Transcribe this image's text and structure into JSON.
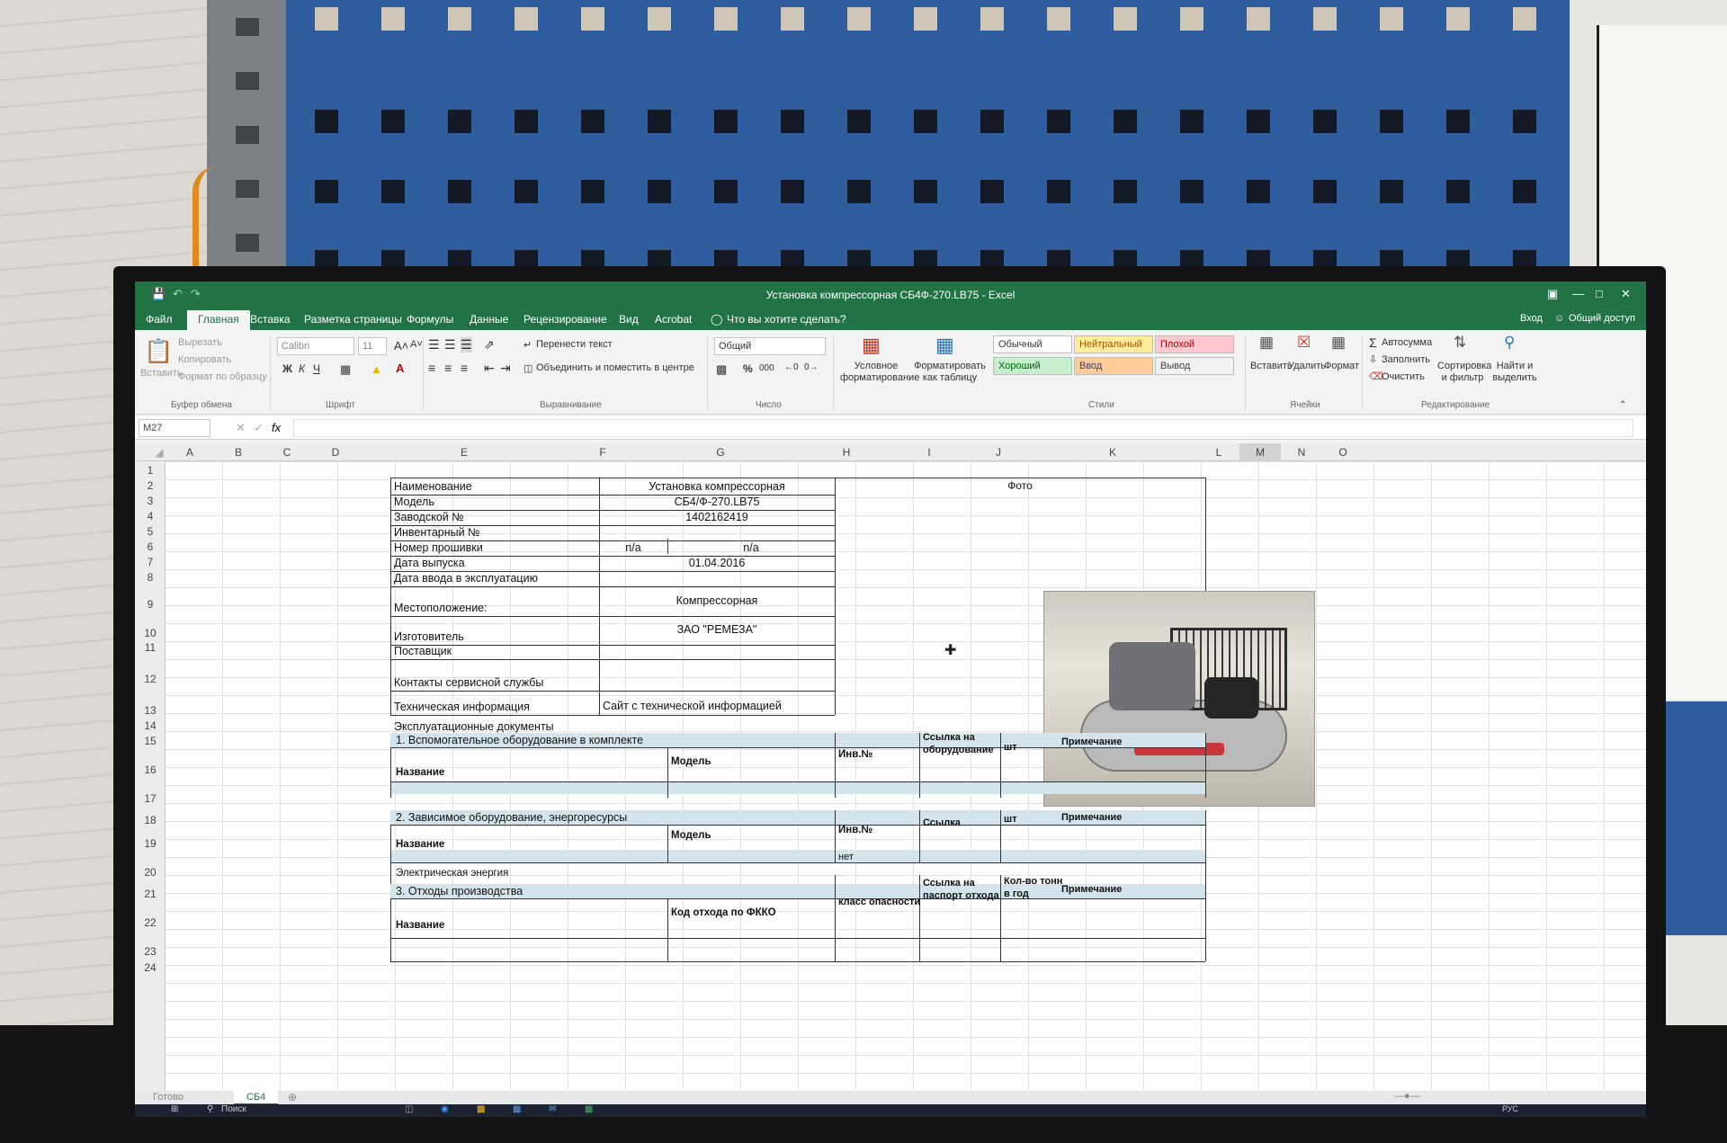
{
  "window": {
    "title": "Установка компрессорная СБ4Ф-270.LB75 - Excel",
    "sign_in": "Вход",
    "share": "Общий доступ"
  },
  "tabs": [
    "Файл",
    "Главная",
    "Вставка",
    "Разметка страницы",
    "Формулы",
    "Данные",
    "Рецензирование",
    "Вид",
    "Acrobat"
  ],
  "active_tab": "Главная",
  "tell_me": "Что вы хотите сделать?",
  "ribbon": {
    "clipboard": {
      "paste": "Вставить",
      "cut": "Вырезать",
      "copy": "Копировать",
      "format_painter": "Формат по образцу",
      "group": "Буфер обмена"
    },
    "font": {
      "name": "Calibri",
      "size": "11",
      "bold": "Ж",
      "italic": "К",
      "underline": "Ч",
      "group": "Шрифт"
    },
    "alignment": {
      "wrap": "Перенести текст",
      "merge": "Объединить и поместить в центре",
      "group": "Выравнивание"
    },
    "number": {
      "format": "Общий",
      "percent": "%",
      "thousands": "000",
      "group": "Число"
    },
    "conditional": "Условное форматирование",
    "format_table": "Форматировать как таблицу",
    "styles": {
      "normal": "Обычный",
      "neutral": "Нейтральный",
      "bad": "Плохой",
      "good": "Хороший",
      "input": "Ввод",
      "output": "Вывод",
      "group": "Стили",
      "colors": {
        "normal": "#ffffff",
        "neutral": "#ffeb9c",
        "bad": "#ffc7ce",
        "good": "#c6efce",
        "input": "#ffcc99",
        "output": "#f2f2f2"
      }
    },
    "cells": {
      "insert": "Вставить",
      "delete": "Удалить",
      "format": "Формат",
      "group": "Ячейки"
    },
    "editing": {
      "autosum": "Автосумма",
      "fill": "Заполнить",
      "clear": "Очистить",
      "sort": "Сортировка и фильтр",
      "find": "Найти и выделить",
      "group": "Редактирование"
    }
  },
  "formula_bar": {
    "name_box": "M27",
    "fx": "fx",
    "value": ""
  },
  "columns": [
    "A",
    "B",
    "C",
    "D",
    "E",
    "F",
    "G",
    "H",
    "I",
    "J",
    "K",
    "L",
    "M",
    "N",
    "O"
  ],
  "selected_column": "M",
  "rows": [
    "1",
    "2",
    "3",
    "4",
    "5",
    "6",
    "7",
    "8",
    "9",
    "10",
    "11",
    "12",
    "13",
    "14",
    "15",
    "16",
    "17",
    "18",
    "19",
    "20",
    "21",
    "22",
    "23",
    "24"
  ],
  "sheet": {
    "photo_header": "Фото",
    "fields": [
      {
        "label": "Наименование",
        "value": "Установка компрессорная"
      },
      {
        "label": "Модель",
        "value": "СБ4/Ф-270.LB75"
      },
      {
        "label": "Заводской №",
        "value": "1402162419"
      },
      {
        "label": "Инвентарный №",
        "value": ""
      },
      {
        "label": "Номер прошивки",
        "value": "n/a",
        "value2": "n/a"
      },
      {
        "label": "Дата выпуска",
        "value": "01.04.2016"
      },
      {
        "label": "Дата ввода в эксплуатацию",
        "value": ""
      },
      {
        "label": "Местоположение:",
        "value": "Компрессорная"
      },
      {
        "label": "Изготовитель",
        "value": "ЗАО \"РЕМЕЗА\""
      },
      {
        "label": "Поставщик",
        "value": ""
      },
      {
        "label": "Контакты сервисной службы",
        "value": ""
      },
      {
        "label": "Техническая информация",
        "value": "Сайт с технической информацией"
      }
    ],
    "docs_title": "Эксплуатационные документы",
    "section1": {
      "title": "1. Вспомогательное оборудование в комплекте",
      "name": "Название",
      "model": "Модель",
      "inv": "Инв.№",
      "link": "Ссылка на оборудование",
      "qty": "шт",
      "note": "Примечание"
    },
    "section2": {
      "title": "2. Зависимое оборудование, энергоресурсы",
      "name": "Название",
      "model": "Модель",
      "inv": "Инв.№",
      "link": "Ссылка",
      "qty": "шт",
      "note": "Примечание",
      "row_name": "Электрическая энергия",
      "row_inv": "нет"
    },
    "section3": {
      "title": "3. Отходы производства",
      "name": "Название",
      "code": "Код отхода по ФККО",
      "class": "класс опасности",
      "link": "Ссылка на паспорт отхода",
      "qty": "Кол-во тонн в год",
      "note": "Примечание"
    }
  },
  "sheet_tab": "СБ4",
  "status": "Готово",
  "taskbar": {
    "search": "Поиск",
    "lang": "РУС"
  }
}
